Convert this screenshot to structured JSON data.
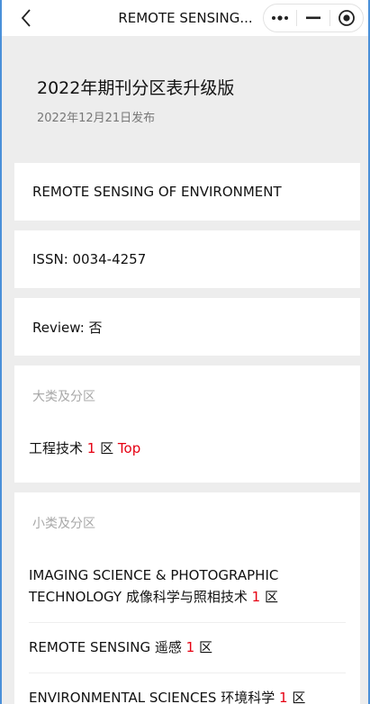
{
  "nav": {
    "title": "REMOTE SENSING...",
    "back_icon": "chevron-left-icon",
    "more_icon": "more-dots-icon",
    "minimize_icon": "minimize-icon",
    "close_icon": "target-close-icon"
  },
  "header": {
    "title": "2022年期刊分区表升级版",
    "date": "2022年12月21日发布"
  },
  "journal": {
    "name": "REMOTE SENSING OF ENVIRONMENT",
    "issn": "ISSN: 0034-4257",
    "review": "Review: 否"
  },
  "major": {
    "label": "大类及分区",
    "category": "工程技术",
    "zone": "1",
    "zone_unit": "区",
    "top": "Top"
  },
  "minor": {
    "label": "小类及分区",
    "items": [
      {
        "line1": "IMAGING SCIENCE & PHOTOGRAPHIC",
        "line2": "TECHNOLOGY 成像科学与照相技术",
        "zone": "1",
        "unit": "区"
      },
      {
        "name": "REMOTE SENSING 遥感",
        "zone": "1",
        "unit": "区"
      },
      {
        "name": "ENVIRONMENTAL SCIENCES 环境科学",
        "zone": "1",
        "unit": "区"
      }
    ]
  },
  "colors": {
    "accent_red": "#e60012",
    "frame_blue": "#4a90d9",
    "background": "#ededed"
  }
}
